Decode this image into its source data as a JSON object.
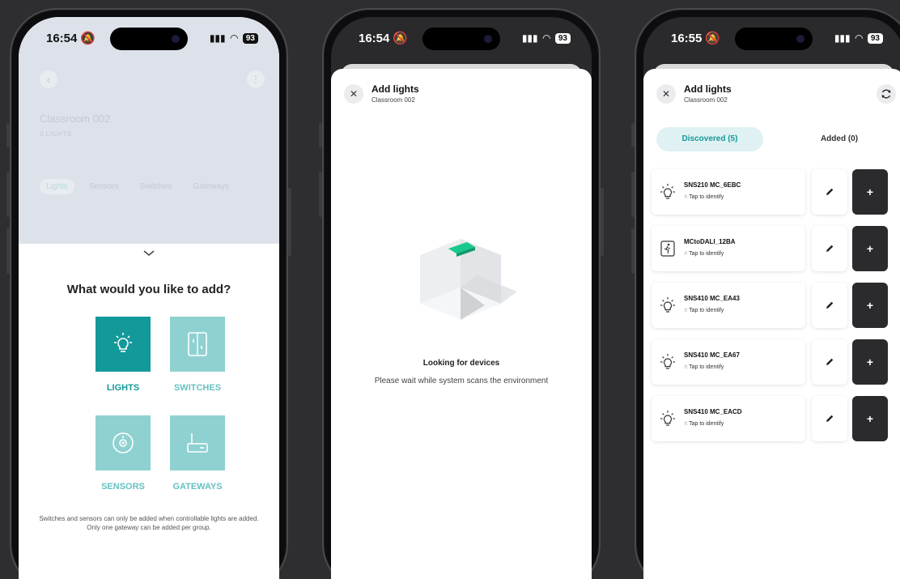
{
  "phone1": {
    "status": {
      "time": "16:54",
      "battery": "93"
    },
    "background": {
      "room": "Classroom 002",
      "count": "0 LIGHTS",
      "tabs": [
        "Lights",
        "Sensors",
        "Switches",
        "Gateways"
      ]
    },
    "title": "What would you like to add?",
    "tiles": [
      {
        "label": "LIGHTS",
        "icon": "bulb-icon",
        "selected": true
      },
      {
        "label": "SWITCHES",
        "icon": "switch-icon",
        "selected": false
      },
      {
        "label": "SENSORS",
        "icon": "sensor-icon",
        "selected": false
      },
      {
        "label": "GATEWAYS",
        "icon": "gateway-icon",
        "selected": false
      }
    ],
    "note": "Switches and sensors can only be added when controllable lights are added. Only one gateway can be added per group."
  },
  "phone2": {
    "status": {
      "time": "16:54",
      "battery": "93"
    },
    "header": {
      "title": "Add lights",
      "subtitle": "Classroom 002"
    },
    "heading": "Looking for devices",
    "message": "Please wait while system scans the environment"
  },
  "phone3": {
    "status": {
      "time": "16:55",
      "battery": "93"
    },
    "header": {
      "title": "Add lights",
      "subtitle": "Classroom 002"
    },
    "tabs": {
      "discovered": "Discovered (5)",
      "added": "Added (0)"
    },
    "devices": [
      {
        "name": "SNS210 MC_6EBC",
        "hint": "Tap to identify",
        "icon": "bulb-icon"
      },
      {
        "name": "MCtoDALI_12BA",
        "hint": "Tap to identify",
        "icon": "exit-sign-icon"
      },
      {
        "name": "SNS410 MC_EA43",
        "hint": "Tap to identify",
        "icon": "bulb-icon"
      },
      {
        "name": "SNS410 MC_EA67",
        "hint": "Tap to identify",
        "icon": "bulb-icon"
      },
      {
        "name": "SNS410 MC_EACD",
        "hint": "Tap to identify",
        "icon": "bulb-icon"
      }
    ],
    "add_label": "+"
  },
  "colors": {
    "accent": "#14999a",
    "accent_light": "#8fd1d1",
    "dark_button": "#2b2b2e",
    "page_bg": "#2e2e31"
  }
}
